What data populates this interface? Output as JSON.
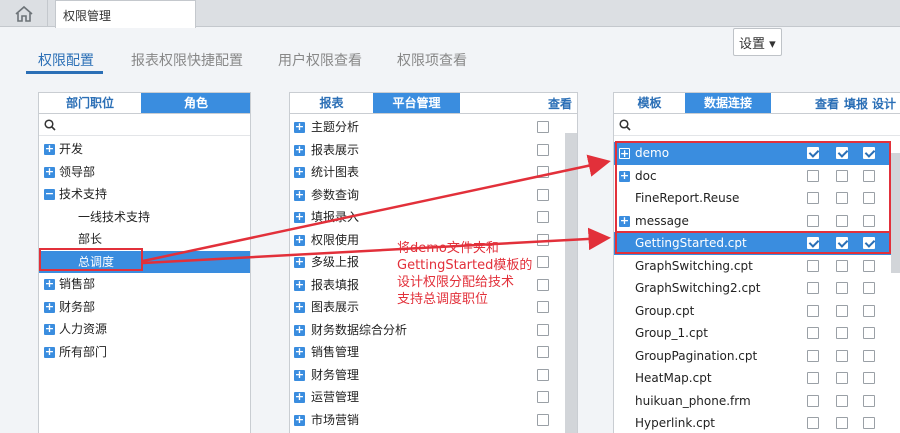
{
  "window": {
    "tab_title": "权限管理"
  },
  "nav": {
    "tabs": [
      "权限配置",
      "报表权限快捷配置",
      "用户权限查看",
      "权限项查看"
    ]
  },
  "settings_label": "设置 ▾",
  "left_panel": {
    "tabs": [
      "部门职位",
      "角色"
    ],
    "items": [
      "开发",
      "领导部",
      "技术支持",
      "一线技术支持",
      "部长",
      "总调度",
      "销售部",
      "财务部",
      "人力资源",
      "所有部门"
    ]
  },
  "mid_panel": {
    "tabs": [
      "报表",
      "平台管理"
    ],
    "col": "查看",
    "items": [
      "主题分析",
      "报表展示",
      "统计图表",
      "参数查询",
      "填报录入",
      "权限使用",
      "多级上报",
      "报表填报",
      "图表展示",
      "财务数据综合分析",
      "销售管理",
      "财务管理",
      "运营管理",
      "市场营销"
    ]
  },
  "right_panel": {
    "tabs": [
      "模板",
      "数据连接"
    ],
    "cols": [
      "查看",
      "填报",
      "设计"
    ],
    "items": [
      {
        "name": "demo",
        "checks": [
          true,
          true,
          true
        ]
      },
      {
        "name": "doc",
        "checks": [
          false,
          false,
          false
        ]
      },
      {
        "name": "FineReport.Reuse",
        "checks": [
          false,
          false,
          false
        ]
      },
      {
        "name": "message",
        "checks": [
          false,
          false,
          false
        ]
      },
      {
        "name": "GettingStarted.cpt",
        "checks": [
          true,
          true,
          true
        ]
      },
      {
        "name": "GraphSwitching.cpt",
        "checks": [
          false,
          false,
          false
        ]
      },
      {
        "name": "GraphSwitching2.cpt",
        "checks": [
          false,
          false,
          false
        ]
      },
      {
        "name": "Group.cpt",
        "checks": [
          false,
          false,
          false
        ]
      },
      {
        "name": "Group_1.cpt",
        "checks": [
          false,
          false,
          false
        ]
      },
      {
        "name": "GroupPagination.cpt",
        "checks": [
          false,
          false,
          false
        ]
      },
      {
        "name": "HeatMap.cpt",
        "checks": [
          false,
          false,
          false
        ]
      },
      {
        "name": "huikuan_phone.frm",
        "checks": [
          false,
          false,
          false
        ]
      },
      {
        "name": "Hyperlink.cpt",
        "checks": [
          false,
          false,
          false
        ]
      }
    ]
  },
  "annotation": [
    "将demo文件夹和",
    "GettingStarted模板的",
    "设计权限分配给技术",
    "支持总调度职位"
  ],
  "colors": {
    "accent": "#3a8ddf",
    "highlight_row": "#3a8ddf",
    "annotation": "#e2303a"
  }
}
